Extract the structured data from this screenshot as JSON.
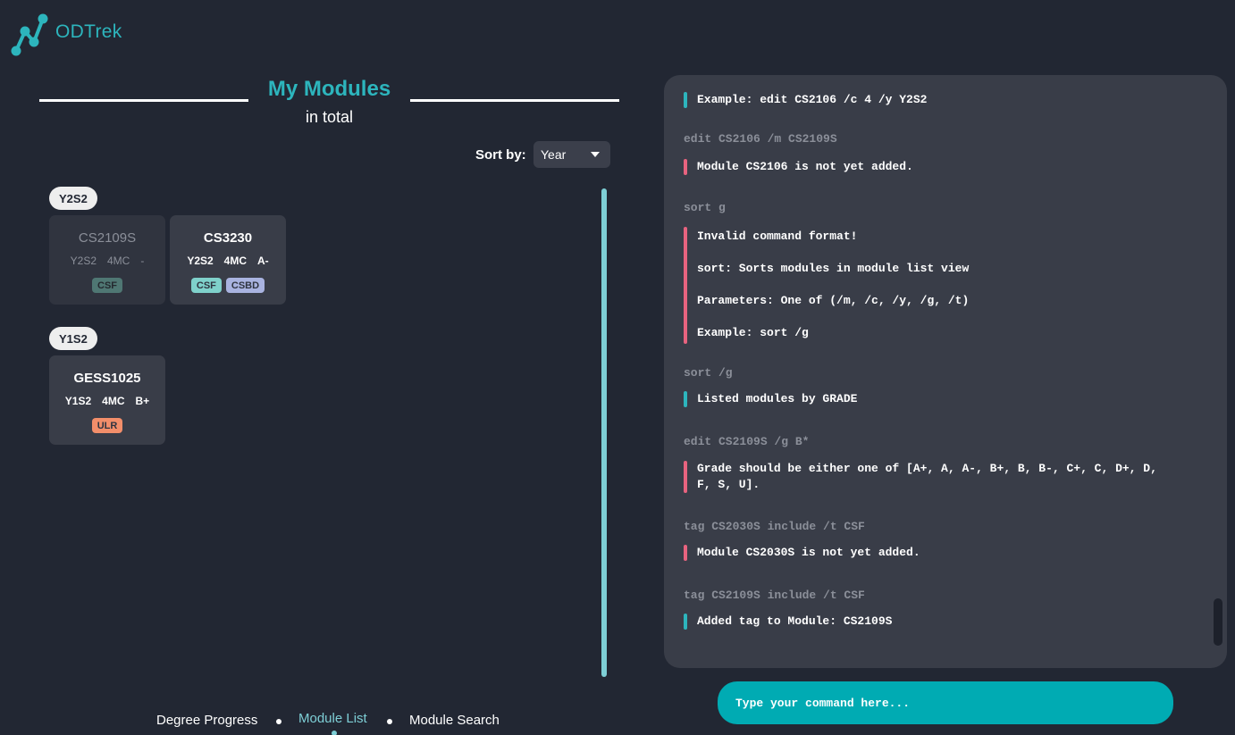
{
  "app": {
    "name": "ODTrek",
    "logo_icon": "odtrek-logo-icon"
  },
  "header": {
    "title": "My Modules",
    "subtitle": "in total"
  },
  "sort": {
    "label": "Sort by:",
    "selected": "Year"
  },
  "groups": [
    {
      "year": "Y2S2",
      "modules": [
        {
          "code": "CS2109S",
          "year": "Y2S2",
          "credits": "4MC",
          "grade": "-",
          "tags": [
            "CSF"
          ],
          "faded": true
        },
        {
          "code": "CS3230",
          "year": "Y2S2",
          "credits": "4MC",
          "grade": "A-",
          "tags": [
            "CSF",
            "CSBD"
          ],
          "faded": false
        }
      ]
    },
    {
      "year": "Y1S2",
      "modules": [
        {
          "code": "GESS1025",
          "year": "Y1S2",
          "credits": "4MC",
          "grade": "B+",
          "tags": [
            "ULR"
          ],
          "faded": false
        }
      ]
    }
  ],
  "nav": {
    "items": [
      "Degree Progress",
      "Module List",
      "Module Search"
    ],
    "active": "Module List"
  },
  "log": [
    {
      "kind": "ok",
      "lines": [
        "Example: edit CS2106 /c 4 /y Y2S2"
      ]
    },
    {
      "kind": "cmd",
      "text": "edit CS2106 /m CS2109S"
    },
    {
      "kind": "err",
      "lines": [
        "Module CS2106 is not yet added."
      ]
    },
    {
      "kind": "cmd",
      "text": "sort g"
    },
    {
      "kind": "err",
      "lines": [
        "Invalid command format!",
        "sort: Sorts modules in module list view",
        "Parameters: One of (/m, /c, /y, /g, /t)",
        "Example: sort /g"
      ]
    },
    {
      "kind": "cmd",
      "text": "sort /g"
    },
    {
      "kind": "ok",
      "lines": [
        "Listed modules by GRADE"
      ]
    },
    {
      "kind": "cmd",
      "text": "edit CS2109S /g B*"
    },
    {
      "kind": "err",
      "lines": [
        "Grade should be either one of [A+, A, A-, B+, B, B-, C+, C, D+, D,\nF, S, U]."
      ]
    },
    {
      "kind": "cmd",
      "text": "tag CS2030S include /t CSF"
    },
    {
      "kind": "err",
      "lines": [
        "Module CS2030S is not yet added."
      ]
    },
    {
      "kind": "cmd",
      "text": "tag CS2109S include /t CSF"
    },
    {
      "kind": "ok",
      "lines": [
        "Added tag to Module: CS2109S"
      ]
    }
  ],
  "command": {
    "placeholder": "Type your command here..."
  },
  "colors": {
    "accent": "#2db5bd",
    "error": "#e8637f",
    "background": "#222733",
    "panel": "#393d48"
  }
}
